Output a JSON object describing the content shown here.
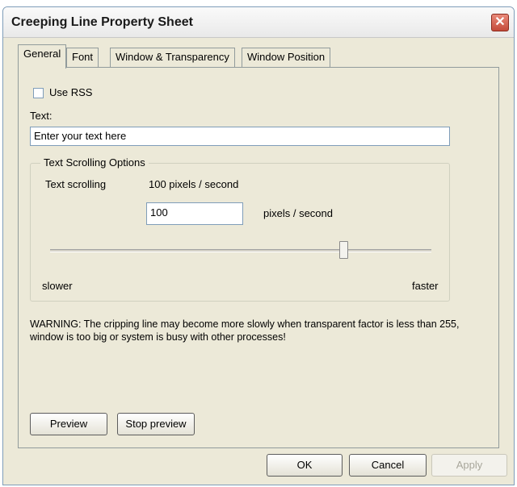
{
  "window": {
    "title": "Creeping Line Property Sheet",
    "close_icon": "close-icon"
  },
  "tabs": [
    {
      "label": "General",
      "active": true
    },
    {
      "label": "Font"
    },
    {
      "label": "Window & Transparency"
    },
    {
      "label": "Window Position"
    }
  ],
  "general": {
    "use_rss_label": "Use RSS",
    "use_rss_checked": false,
    "text_label": "Text:",
    "text_value": "Enter your text here",
    "group_title": "Text Scrolling Options",
    "scrolling_label": "Text scrolling",
    "scrolling_value_display": "100 pixels / second",
    "speed_value": "100",
    "speed_unit": "pixels / second",
    "slider_fraction": 0.77,
    "slower_label": "slower",
    "faster_label": "faster",
    "warning": "WARNING: The cripping line may become more slowly when transparent factor is less than 255, window is too big or system is busy with other processes!",
    "preview_button": "Preview",
    "stop_preview_button": "Stop preview"
  },
  "footer": {
    "ok": "OK",
    "cancel": "Cancel",
    "apply": "Apply"
  }
}
